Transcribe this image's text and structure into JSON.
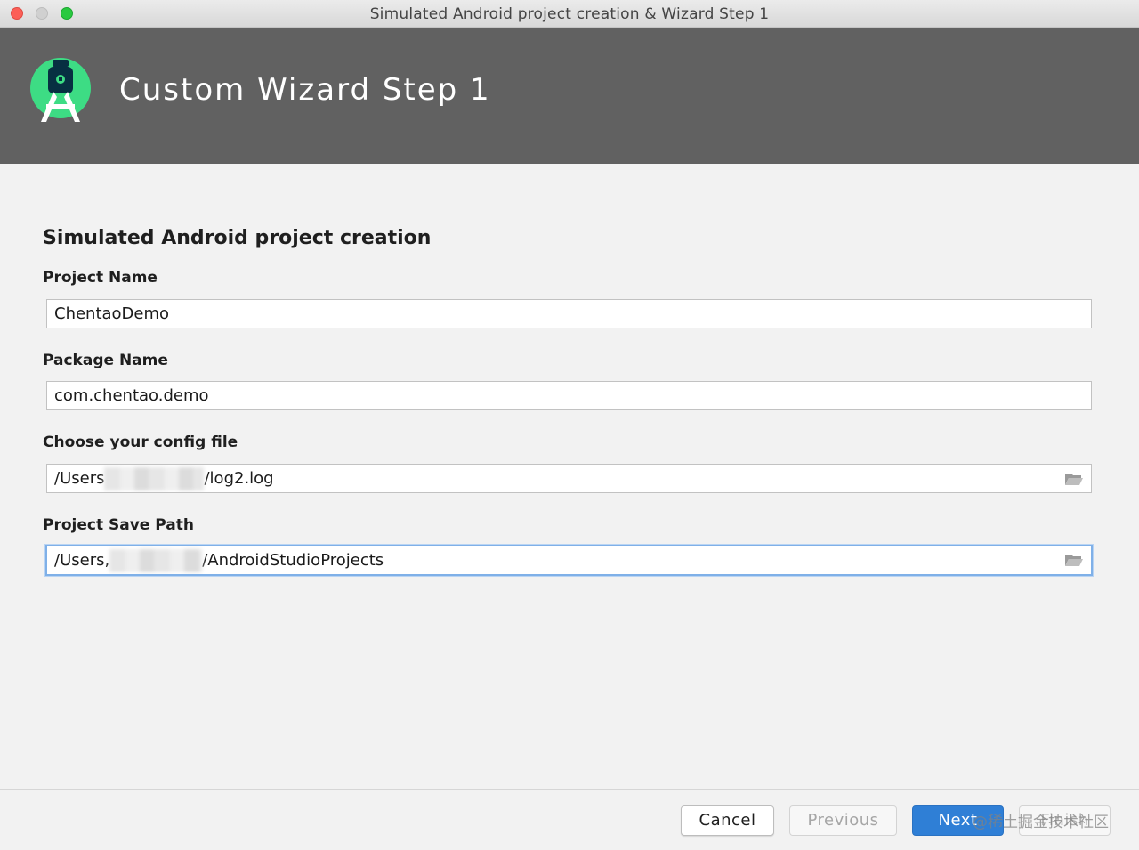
{
  "window": {
    "title": "Simulated Android project creation & Wizard Step 1"
  },
  "banner": {
    "title": "Custom Wizard Step 1",
    "logo_icon": "android-studio-logo-icon",
    "background": "#616161",
    "logo_color": "#3ddc84"
  },
  "form": {
    "section_title": "Simulated Android project creation",
    "fields": [
      {
        "label": "Project Name",
        "value": "ChentaoDemo"
      },
      {
        "label": "Package Name",
        "value": "com.chentao.demo"
      },
      {
        "label": "Choose your config file",
        "value_prefix": "/Users",
        "value_suffix": "/log2.log",
        "icon": "folder-open-icon"
      },
      {
        "label": "Project Save Path",
        "value_prefix": "/Users,",
        "value_suffix": "/AndroidStudioProjects",
        "icon": "folder-open-icon",
        "focused": true
      }
    ]
  },
  "buttons": {
    "cancel": "Cancel",
    "previous": "Previous",
    "next": "Next",
    "finish": "Finish"
  },
  "watermark": "@稀土掘金技术社区",
  "colors": {
    "primary_button": "#2f7fd6",
    "focus_ring": "#7fb0e8"
  }
}
